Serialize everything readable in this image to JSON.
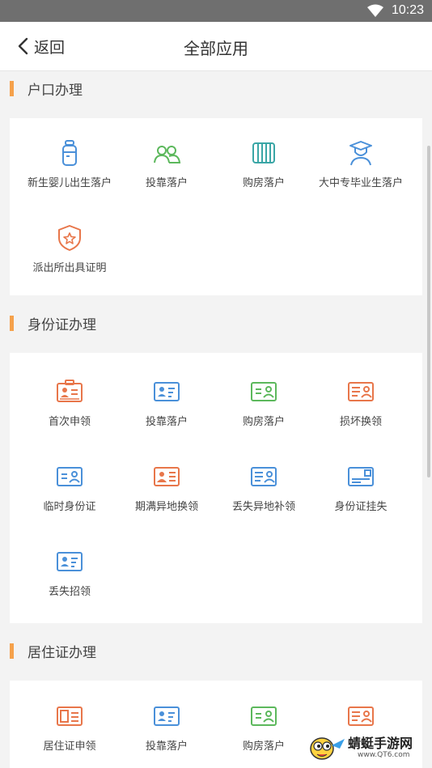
{
  "status_bar": {
    "time": "10:23"
  },
  "header": {
    "back_label": "返回",
    "title": "全部应用"
  },
  "sections": [
    {
      "title": "户口办理",
      "items": [
        {
          "label": "新生婴儿出生落户",
          "icon": "baby-bottle-icon"
        },
        {
          "label": "投靠落户",
          "icon": "people-icon"
        },
        {
          "label": "购房落户",
          "icon": "radiator-icon"
        },
        {
          "label": "大中专毕业生落户",
          "icon": "graduate-icon"
        },
        {
          "label": "派出所出具证明",
          "icon": "police-badge-icon"
        }
      ]
    },
    {
      "title": "身份证办理",
      "items": [
        {
          "label": "首次申领",
          "icon": "id-card-badge-icon"
        },
        {
          "label": "投靠落户",
          "icon": "id-card-icon"
        },
        {
          "label": "购房落户",
          "icon": "id-card-icon"
        },
        {
          "label": "损坏换领",
          "icon": "id-card-icon"
        },
        {
          "label": "临时身份证",
          "icon": "id-card-icon"
        },
        {
          "label": "期满异地换领",
          "icon": "id-card-icon"
        },
        {
          "label": "丢失异地补领",
          "icon": "id-card-icon"
        },
        {
          "label": "身份证挂失",
          "icon": "id-card-icon"
        },
        {
          "label": "丢失招领",
          "icon": "id-card-icon"
        }
      ]
    },
    {
      "title": "居住证办理",
      "items": [
        {
          "label": "居住证申领",
          "icon": "residence-card-icon"
        },
        {
          "label": "投靠落户",
          "icon": "id-card-icon"
        },
        {
          "label": "购房落户",
          "icon": "id-card-icon"
        },
        {
          "label": "",
          "icon": "id-card-icon"
        }
      ]
    }
  ],
  "watermark": {
    "title": "蜻蜓手游网",
    "url": "www.QT6.com"
  },
  "colors": {
    "accent": "#f5a14b",
    "icon_blue": "#4a90d9",
    "icon_green": "#5cb85c",
    "icon_teal": "#3aa6a6",
    "icon_orange": "#e8764a"
  }
}
